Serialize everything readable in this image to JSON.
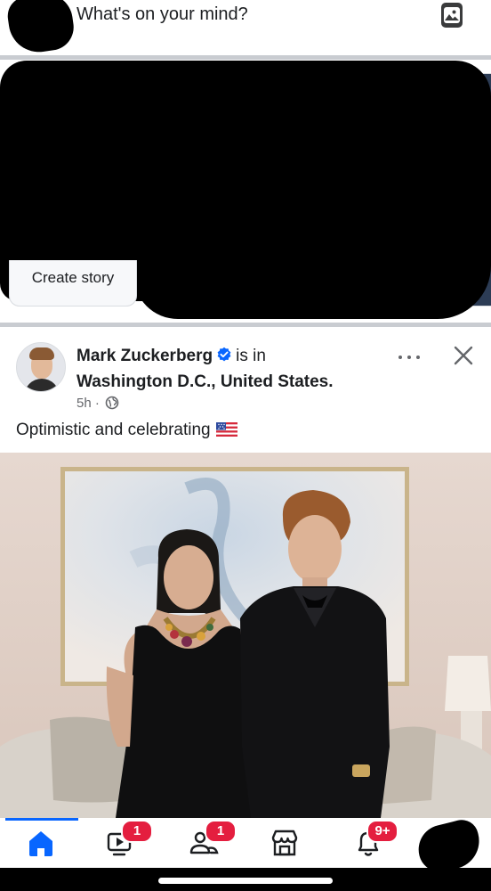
{
  "composer": {
    "placeholder": "What's on your mind?",
    "photo_icon": "photo-icon"
  },
  "stories": {
    "create_label": "Create story"
  },
  "post": {
    "author": "Mark Zuckerberg",
    "verified_icon": "verified-badge-icon",
    "status_text": "is in",
    "location": "Washington D.C., United States.",
    "time": "5h",
    "separator": "·",
    "audience_icon": "globe-icon",
    "text": "Optimistic and celebrating",
    "emoji": "us-flag-icon",
    "more_icon": "more-icon",
    "close_icon": "close-icon"
  },
  "bottom_nav": {
    "accent": "#0866ff",
    "badge_color": "#e41e3f",
    "items": [
      {
        "icon": "home-icon",
        "badge": ""
      },
      {
        "icon": "video-icon",
        "badge": "1"
      },
      {
        "icon": "friends-icon",
        "badge": "1"
      },
      {
        "icon": "marketplace-icon",
        "badge": ""
      },
      {
        "icon": "notifications-icon",
        "badge": "9+"
      },
      {
        "icon": "profile-icon",
        "badge": ""
      }
    ]
  }
}
